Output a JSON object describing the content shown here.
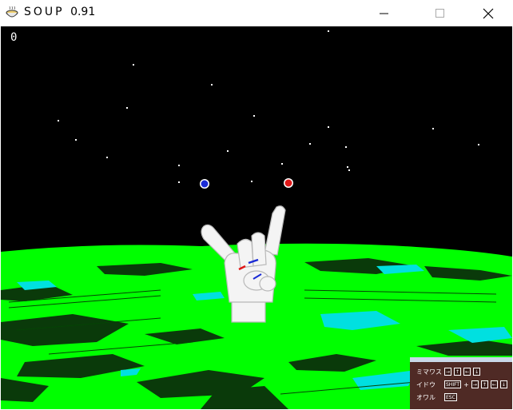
{
  "window": {
    "title": "SOUP",
    "version": "0.91",
    "icon": "bowl-icon",
    "controls": [
      "minimize-icon",
      "maximize-icon",
      "close-icon"
    ]
  },
  "hud": {
    "score": "0"
  },
  "help": {
    "rows": [
      {
        "label": "ミマワス",
        "keys": [
          "→",
          "↑",
          "←",
          "↓"
        ]
      },
      {
        "label": "イドウ",
        "modifier": "SHIFT",
        "plus": "+",
        "keys": [
          "→",
          "↑",
          "←",
          "↓"
        ]
      },
      {
        "label": "オワル",
        "keys": [
          "ESC"
        ]
      }
    ]
  },
  "colors": {
    "sky": "#000000",
    "ground": "#00ff00",
    "ground_dark": "#0a3a0a",
    "water": "#00ffff",
    "help_bg": "#4f2a25",
    "orb_left": "#1a2bd6",
    "orb_right": "#e01818"
  }
}
